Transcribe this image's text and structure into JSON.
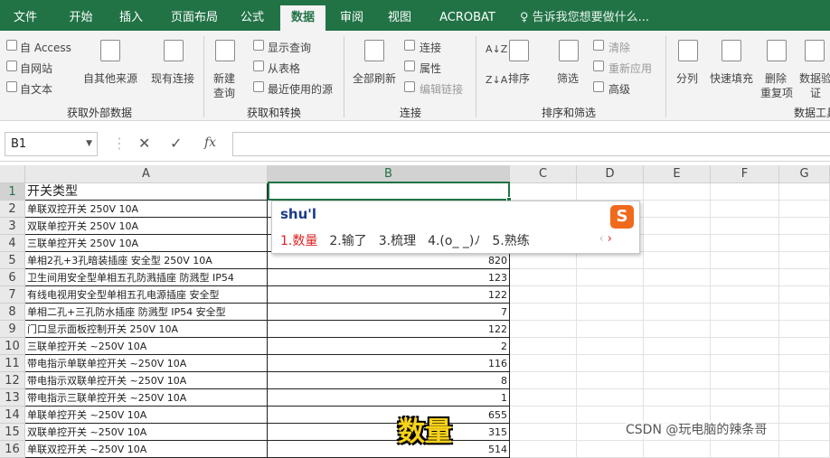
{
  "tabs": [
    {
      "label": "文件",
      "active": false
    },
    {
      "label": "开始",
      "active": false
    },
    {
      "label": "插入",
      "active": false
    },
    {
      "label": "页面布局",
      "active": false
    },
    {
      "label": "公式",
      "active": false
    },
    {
      "label": "数据",
      "active": true
    },
    {
      "label": "审阅",
      "active": false
    },
    {
      "label": "视图",
      "active": false
    },
    {
      "label": "ACROBAT",
      "active": false
    }
  ],
  "tellme": "♀ 告诉我您想要做什么...",
  "ribbon": {
    "external": {
      "access": "自 Access",
      "web": "自网站",
      "text": "自文本",
      "other": "自其他来源",
      "existing": "现有连接",
      "group": "获取外部数据"
    },
    "transform": {
      "newquery1": "新建",
      "newquery2": "查询",
      "show": "显示查询",
      "fromtable": "从表格",
      "recent": "最近使用的源",
      "group": "获取和转换"
    },
    "connections": {
      "refresh": "全部刷新",
      "conn": "连接",
      "props": "属性",
      "edit": "编辑链接",
      "group": "连接"
    },
    "sort": {
      "sort": "排序",
      "filter": "筛选",
      "clear": "清除",
      "reapply": "重新应用",
      "advanced": "高级",
      "group": "排序和筛选"
    },
    "tools": {
      "split": "分列",
      "flash": "快速填充",
      "dedupe1": "删除",
      "dedupe2": "重复项",
      "valid1": "数据验",
      "valid2": "证",
      "group": "数据工具"
    }
  },
  "formula_bar": {
    "name_box": "B1",
    "cancel": "✕",
    "enter": "✓",
    "fx": "fx",
    "value": ""
  },
  "columns": [
    "A",
    "B",
    "C",
    "D",
    "E",
    "F",
    "G"
  ],
  "rows": [
    {
      "n": "1",
      "a": "开关类型",
      "b": ""
    },
    {
      "n": "2",
      "a": "单联双控开关 250V 10A",
      "b": ""
    },
    {
      "n": "3",
      "a": "双联单控开关 250V 10A",
      "b": ""
    },
    {
      "n": "4",
      "a": "三联单控开关 250V 10A",
      "b": ""
    },
    {
      "n": "5",
      "a": "单相2孔+3孔暗装插座 安全型 250V 10A",
      "b": "820"
    },
    {
      "n": "6",
      "a": "卫生间用安全型单相五孔防溅插座 防溅型 IP54",
      "b": "123"
    },
    {
      "n": "7",
      "a": "有线电视用安全型单相五孔电源插座 安全型",
      "b": "122"
    },
    {
      "n": "8",
      "a": "单相二孔+三孔防水插座 防溅型 IP54 安全型",
      "b": "7"
    },
    {
      "n": "9",
      "a": "门口显示面板控制开关 250V 10A",
      "b": "122"
    },
    {
      "n": "10",
      "a": "三联单控开关 ~250V 10A",
      "b": "2"
    },
    {
      "n": "11",
      "a": "带电指示单联单控开关 ~250V 10A",
      "b": "116"
    },
    {
      "n": "12",
      "a": "带电指示双联单控开关 ~250V 10A",
      "b": "8"
    },
    {
      "n": "13",
      "a": "带电指示三联单控开关 ~250V 10A",
      "b": "1"
    },
    {
      "n": "14",
      "a": "单联单控开关 ~250V 10A",
      "b": "655"
    },
    {
      "n": "15",
      "a": "双联单控开关 ~250V 10A",
      "b": "315"
    },
    {
      "n": "16",
      "a": "单联双控开关 ~250V 10A",
      "b": "514"
    }
  ],
  "ime": {
    "composition": "shu'l",
    "candidates": [
      "1.数量",
      "2.输了",
      "3.梳理",
      "4.(o_ _)ﾉ",
      "5.熟练"
    ],
    "logo": "S",
    "nav_prev": "‹",
    "nav_next": "›"
  },
  "caption": "数量",
  "watermark": "CSDN @玩电脑的辣条哥"
}
